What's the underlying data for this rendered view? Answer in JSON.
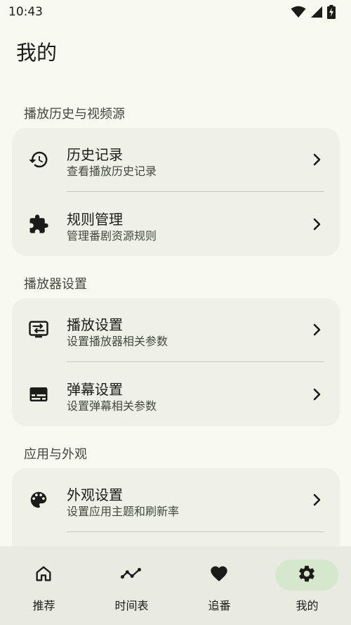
{
  "status_bar": {
    "time": "10:43",
    "icons": [
      "wifi-icon",
      "signal-icon",
      "battery-charging-icon"
    ]
  },
  "page": {
    "title": "我的"
  },
  "sections": [
    {
      "header": "播放历史与视频源",
      "items": [
        {
          "title": "历史记录",
          "subtitle": "查看播放历史记录",
          "icon": "history-icon"
        },
        {
          "title": "规则管理",
          "subtitle": "管理番剧资源规则",
          "icon": "puzzle-icon"
        }
      ]
    },
    {
      "header": "播放器设置",
      "items": [
        {
          "title": "播放设置",
          "subtitle": "设置播放器相关参数",
          "icon": "player-settings-icon"
        },
        {
          "title": "弹幕设置",
          "subtitle": "设置弹幕相关参数",
          "icon": "subtitles-icon"
        }
      ]
    },
    {
      "header": "应用与外观",
      "items": [
        {
          "title": "外观设置",
          "subtitle": "设置应用主题和刷新率",
          "icon": "palette-icon"
        }
      ]
    }
  ],
  "bottom_nav": {
    "items": [
      {
        "label": "推荐",
        "icon": "home-icon",
        "active": false
      },
      {
        "label": "时间表",
        "icon": "timeline-icon",
        "active": false
      },
      {
        "label": "追番",
        "icon": "heart-icon",
        "active": false
      },
      {
        "label": "我的",
        "icon": "gear-icon",
        "active": true
      }
    ]
  },
  "colors": {
    "background": "#f8f9f1",
    "card": "#eff1e8",
    "nav_background": "#e9ebe2",
    "nav_active_pill": "#d5e8cd",
    "text_primary": "#1b1c18",
    "text_secondary": "#44483e"
  }
}
